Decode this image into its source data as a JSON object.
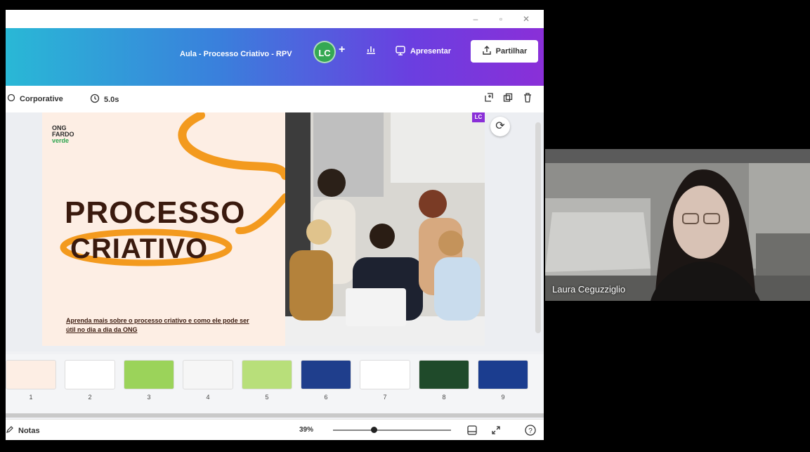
{
  "window": {
    "minimize": "–",
    "maximize": "▫",
    "close": "✕"
  },
  "topbar": {
    "doc_title": "Aula - Processo Criativo - RPV",
    "avatar_initials": "LC",
    "add_label": "+",
    "present_label": "Apresentar",
    "share_label": "Partilhar"
  },
  "toolbar": {
    "font": "Corporative",
    "duration": "5.0s"
  },
  "slide": {
    "logo_line1": "ONG",
    "logo_line2": "FARDO",
    "logo_line3": "verde",
    "title_line1": "PROCESSO",
    "title_line2": "CRIATIVO",
    "subtitle": "Aprenda mais sobre o processo criativo e como ele pode ser útil no dia a dia da ONG",
    "badge": "LC"
  },
  "thumbnails": [
    {
      "num": "1",
      "bg": "#fdeee4"
    },
    {
      "num": "2",
      "bg": "#ffffff"
    },
    {
      "num": "3",
      "bg": "#9bd35a"
    },
    {
      "num": "4",
      "bg": "#f6f6f6"
    },
    {
      "num": "5",
      "bg": "#b8df7a"
    },
    {
      "num": "6",
      "bg": "#1f3e8c"
    },
    {
      "num": "7",
      "bg": "#ffffff"
    },
    {
      "num": "8",
      "bg": "#1f4a2a"
    },
    {
      "num": "9",
      "bg": "#1b3d8f"
    }
  ],
  "bottombar": {
    "notes_label": "Notas",
    "zoom": "39%"
  },
  "webcam": {
    "participant_name": "Laura Ceguzziglio"
  },
  "colors": {
    "title": "#3a1a0e",
    "accent_orange": "#f39a1e",
    "brand_purple": "#8a2fd8"
  }
}
